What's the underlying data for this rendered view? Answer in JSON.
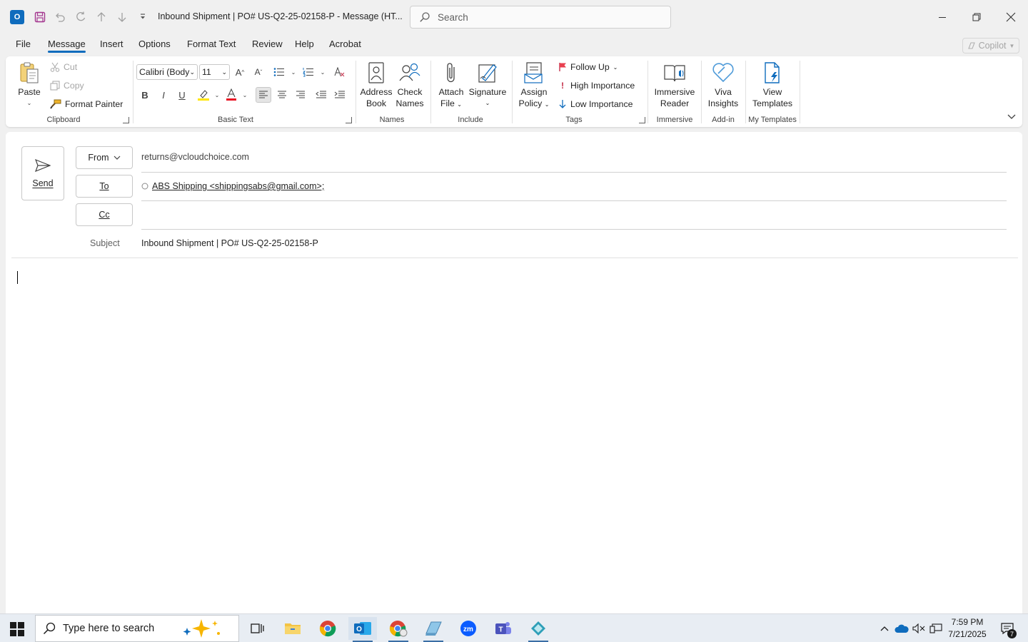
{
  "window": {
    "title": "Inbound Shipment | PO# US-Q2-25-02158-P  -  Message (HT...",
    "search_placeholder": "Search"
  },
  "tabs": [
    "File",
    "Message",
    "Insert",
    "Options",
    "Format Text",
    "Review",
    "Help",
    "Acrobat"
  ],
  "active_tab": "Message",
  "copilot_label": "Copilot",
  "ribbon": {
    "clipboard": {
      "paste": "Paste",
      "cut": "Cut",
      "copy": "Copy",
      "format_painter": "Format Painter",
      "label": "Clipboard"
    },
    "basic_text": {
      "font": "Calibri (Body",
      "size": "11",
      "label": "Basic Text"
    },
    "names": {
      "address_book_1": "Address",
      "address_book_2": "Book",
      "check_names_1": "Check",
      "check_names_2": "Names",
      "label": "Names"
    },
    "include": {
      "attach_1": "Attach",
      "attach_2": "File",
      "signature": "Signature",
      "label": "Include"
    },
    "tags": {
      "assign_1": "Assign",
      "assign_2": "Policy",
      "follow_up": "Follow Up",
      "high": "High Importance",
      "low": "Low Importance",
      "label": "Tags"
    },
    "immersive": {
      "reader_1": "Immersive",
      "reader_2": "Reader",
      "label": "Immersive"
    },
    "addin": {
      "viva_1": "Viva",
      "viva_2": "Insights",
      "label": "Add-in"
    },
    "templates": {
      "view_1": "View",
      "view_2": "Templates",
      "label": "My Templates"
    }
  },
  "compose": {
    "send": "Send",
    "from_label": "From",
    "from_value": "returns@vcloudchoice.com",
    "to_label": "To",
    "to_value": "ABS Shipping <shippingsabs@gmail.com>;",
    "cc_label": "Cc",
    "subject_label": "Subject",
    "subject_value": "Inbound Shipment | PO# US-Q2-25-02158-P"
  },
  "taskbar": {
    "search_placeholder": "Type here to search",
    "time": "7:59 PM",
    "date": "7/21/2025",
    "notification_count": "7"
  },
  "colors": {
    "accent": "#0f6cbd",
    "ribbon_bg": "#ffffff",
    "chrome_bg": "#f0f0f0"
  }
}
